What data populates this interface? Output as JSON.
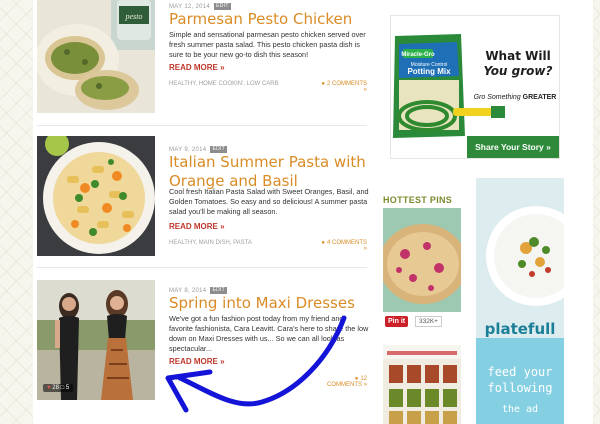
{
  "posts": [
    {
      "date": "MAY 12, 2014",
      "edit": "EDIT",
      "title": "Parmesan Pesto Chicken",
      "excerpt": "Simple and sensational parmesan pesto chicken served over fresh summer pasta salad. This pesto chicken pasta dish is sure to be your new go-to dish this season!",
      "read_more": "READ MORE »",
      "categories": "HEALTHY, HOME COOKIN', LOW CARB",
      "comments": "2 COMMENTS »",
      "thumb_label": "pesto"
    },
    {
      "date": "MAY 9, 2014",
      "edit": "EDIT",
      "title": "Italian Summer Pasta with Orange and Basil",
      "excerpt": "Cool fresh Italian Pasta Salad with Sweet Oranges, Basil, and Golden Tomatoes. So easy and so delicious! A summer pasta salad you'll be making all season.",
      "read_more": "READ MORE »",
      "categories": "HEALTHY, MAIN DISH, PASTA",
      "comments": "4 COMMENTS »"
    },
    {
      "date": "MAY 8, 2014",
      "edit": "EDIT",
      "title": "Spring into Maxi Dresses",
      "excerpt": "We've got a fun fashion post today from my friend and favorite fashionista, Cara Leavitt. Cara's here to share the low down on Maxi Dresses with us... So we can all look as spectacular...",
      "read_more": "READ MORE »",
      "categories": "ENDS",
      "comments": "12 COMMENTS »",
      "likes": "28",
      "comment_count": "5"
    }
  ],
  "ad_miracle_gro": {
    "headline_line1": "What Will",
    "headline_line2": "You grow?",
    "brand": "Miracle-Gro",
    "product_line1": "Moisture Control",
    "product_line2": "Potting Mix",
    "tagline_pre": "Gro Something",
    "tagline_bold": "GREATER",
    "cta": "Share Your Story"
  },
  "sidebar": {
    "hottest_pins_title": "HOTTEST PINS",
    "pin_label": "Pin it",
    "pin_count": "332K+"
  },
  "ad_platefull": {
    "brand": "platefull",
    "line1": "feed your",
    "line2": "following",
    "line3": "the ad"
  }
}
